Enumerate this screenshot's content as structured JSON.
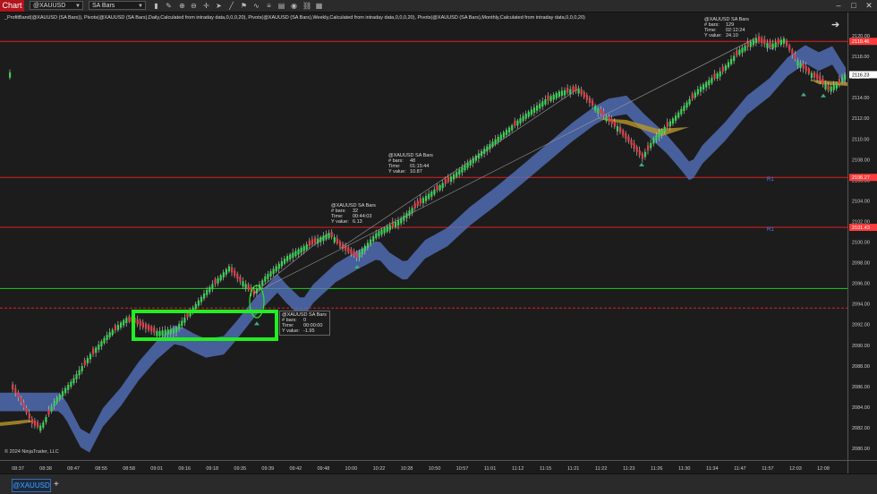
{
  "toolbar": {
    "chart_tag": "Chart",
    "instrument": "@XAUUSD",
    "bar_type": "SA Bars",
    "icons": [
      "bars-type-icon",
      "draw-icon",
      "zoom-in-icon",
      "zoom-out-icon",
      "crosshair-icon",
      "cursor-icon",
      "line-draw-icon",
      "strategy-icon",
      "indicator-icon",
      "properties-icon",
      "template-icon",
      "camera-icon",
      "link-icon",
      "instrument-list-icon"
    ],
    "window_buttons": [
      "minimize-icon",
      "maximize-icon",
      "close-icon"
    ]
  },
  "indicator_line": "_ProfitBand(@XAUUSD (SA Bars)), Pivots(@XAUUSD (SA Bars),Daily,Calculated from intraday data,0,0,0,20), Pivots(@XAUUSD (SA Bars),Weekly,Calculated from intraday data,0,0,0,20), Pivots(@XAUUSD (SA Bars),Monthly,Calculated from intraday data,0,0,0,20)",
  "copyright": "© 2024 NinjaTrader, LLC",
  "y_axis": {
    "ticks": [
      "2120.00",
      "2118.00",
      "2116.00",
      "2114.00",
      "2112.00",
      "2110.00",
      "2108.00",
      "2106.00",
      "2104.00",
      "2102.00",
      "2100.00",
      "2098.00",
      "2096.00",
      "2094.00",
      "2092.00",
      "2090.00",
      "2088.00",
      "2086.00",
      "2084.00",
      "2082.00",
      "2080.00"
    ],
    "price_tags": [
      {
        "label": "2119.46",
        "color": "#ff3b3b"
      },
      {
        "label": "2116.23",
        "color": "#ffffff"
      },
      {
        "label": "2106.27",
        "color": "#ff3b3b"
      },
      {
        "label": "2101.43",
        "color": "#ff3b3b"
      }
    ]
  },
  "x_axis": {
    "ticks": [
      "08:37",
      "08:38",
      "08:47",
      "08:55",
      "08:58",
      "09:01",
      "09:16",
      "09:18",
      "09:35",
      "09:39",
      "09:42",
      "09:48",
      "10:00",
      "10:22",
      "10:28",
      "10:50",
      "10:57",
      "11:01",
      "11:12",
      "11:15",
      "11:21",
      "11:22",
      "11:23",
      "11:26",
      "11:30",
      "11:34",
      "11:47",
      "11:57",
      "12:03",
      "12:08"
    ]
  },
  "pivots": [
    {
      "label": "R2",
      "price": 2119.46,
      "color": "#e02020"
    },
    {
      "label": "R1",
      "price": 2106.27,
      "color": "#e02020"
    },
    {
      "label": "R1",
      "price": 2101.43,
      "color": "#e02020"
    }
  ],
  "support_line": {
    "price": 2095.5,
    "color": "#22cc22"
  },
  "dashed_line": {
    "price": 2093.6,
    "color": "#e02020"
  },
  "tooltips": [
    {
      "title": "@XAUUSD SA Bars",
      "rows": [
        [
          "# bars:",
          "129"
        ],
        [
          "Time:",
          "02:12:24"
        ],
        [
          "Y value:",
          "24.10"
        ]
      ]
    },
    {
      "title": "@XAUUSD SA Bars",
      "rows": [
        [
          "# bars:",
          "48"
        ],
        [
          "Time:",
          "01:15:44"
        ],
        [
          "Y value:",
          "10.87"
        ]
      ]
    },
    {
      "title": "@XAUUSD SA Bars",
      "rows": [
        [
          "# bars:",
          "32"
        ],
        [
          "Time:",
          "00:44:03"
        ],
        [
          "Y value:",
          "6.13"
        ]
      ]
    },
    {
      "title": "@XAUUSD SA Bars",
      "rows": [
        [
          "# bars:",
          "0"
        ],
        [
          "Time:",
          "00:00:00"
        ],
        [
          "Y value:",
          "-1.95"
        ]
      ]
    }
  ],
  "tabs": {
    "active": "@XAUUSD",
    "add": "+"
  },
  "colors": {
    "up": "#39d353",
    "down": "#e0404a",
    "band_blue": "#5576c4",
    "band_gold": "#b8962a",
    "background": "#1c1c1c"
  }
}
